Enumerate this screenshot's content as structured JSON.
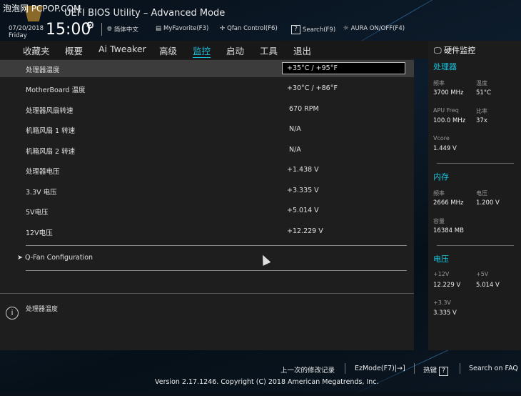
{
  "watermark": "泡泡网 PCPOP.COM",
  "header": {
    "title": "UEFI BIOS Utility – Advanced Mode",
    "date": "07/20/2018",
    "day": "Friday",
    "time": "15:00",
    "toolbar": [
      {
        "icon": "globe-icon",
        "label": "简体中文"
      },
      {
        "icon": "favorite-icon",
        "label": "MyFavorite(F3)"
      },
      {
        "icon": "fan-icon",
        "label": "Qfan Control(F6)"
      },
      {
        "icon": "help-icon",
        "label": "Search(F9)"
      },
      {
        "icon": "aura-icon",
        "label": "AURA ON/OFF(F4)"
      }
    ]
  },
  "tabs": [
    "收藏夹",
    "概要",
    "Ai Tweaker",
    "高级",
    "监控",
    "启动",
    "工具",
    "退出"
  ],
  "active_tab": "监控",
  "rows": [
    {
      "label": "处理器温度",
      "value": "+35°C / +95°F"
    },
    {
      "label": "MotherBoard 温度",
      "value": "+30°C / +86°F"
    },
    {
      "label": "处理器风扇转速",
      "value": "670 RPM"
    },
    {
      "label": "机箱风扇 1 转速",
      "value": "N/A"
    },
    {
      "label": "机箱风扇 2 转速",
      "value": "N/A"
    },
    {
      "label": "处理器电压",
      "value": "+1.438 V"
    },
    {
      "label": "3.3V 电压",
      "value": "+3.335 V"
    },
    {
      "label": "5V电压",
      "value": "+5.014 V"
    },
    {
      "label": "12V电压",
      "value": "+12.229 V"
    }
  ],
  "qfan": "Q-Fan Configuration",
  "help_text": "处理器温度",
  "monitor": {
    "title": "硬件监控",
    "cpu": {
      "title": "处理器",
      "freq_label": "频率",
      "freq": "3700 MHz",
      "temp_label": "温度",
      "temp": "51°C",
      "apu_label": "APU Freq",
      "apu": "100.0 MHz",
      "ratio_label": "比率",
      "ratio": "37x",
      "vcore_label": "Vcore",
      "vcore": "1.449 V"
    },
    "mem": {
      "title": "内存",
      "freq_label": "频率",
      "freq": "2666 MHz",
      "volt_label": "电压",
      "volt": "1.200 V",
      "cap_label": "容量",
      "cap": "16384 MB"
    },
    "volt": {
      "title": "电压",
      "v12_label": "+12V",
      "v12": "12.229 V",
      "v5_label": "+5V",
      "v5": "5.014 V",
      "v33_label": "+3.3V",
      "v33": "3.335 V"
    }
  },
  "footer": {
    "last_mod": "上一次的修改记录",
    "ezmode": "EzMode(F7)",
    "hotkeys": "热键",
    "faq": "Search on FAQ",
    "version": "Version 2.17.1246. Copyright (C) 2018 American Megatrends, Inc."
  }
}
